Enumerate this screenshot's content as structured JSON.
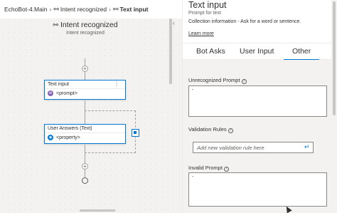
{
  "breadcrumb": {
    "root": "EchoBot-4.Main",
    "trigger": "Intent recognized",
    "current": "Text input"
  },
  "canvas": {
    "trigger_title": "Intent recognized",
    "trigger_subtitle": "Intent recognized",
    "nodes": [
      {
        "header": "Text input",
        "body": "<prompt>",
        "badge_color": "#8764b8"
      },
      {
        "header": "User Answers (Text)",
        "body": "<property>",
        "badge_color": "#0078d4"
      }
    ],
    "menu_glyph": "⋮"
  },
  "panel": {
    "title": "Text input",
    "subtitle": "Prompt for text",
    "description": "Collection information - Ask for a word or sentence.",
    "learn_more": "Learn more",
    "tabs": [
      "Bot Asks",
      "User Input",
      "Other"
    ],
    "active_tab": "Other",
    "unrecognized_label": "Unrecognized Prompt",
    "unrecognized_value": "-",
    "validation_label": "Validation Rules",
    "validation_placeholder": "Add new validation rule here",
    "invalid_label": "Invalid Prompt",
    "invalid_value": "-"
  },
  "colors": {
    "accent": "#0078d4",
    "prompt_badge": "#8764b8"
  }
}
